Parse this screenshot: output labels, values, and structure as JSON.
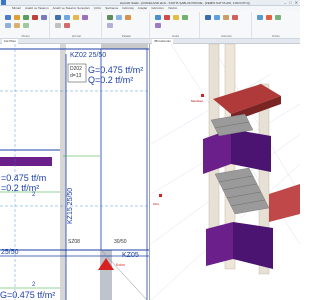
{
  "app": {
    "title": "ideCAD Statik - [CMCELAND.ideS - STATİK ŞABLON PROJE - [ZEMİN KAT PLANI, 3.80 KOTU]]",
    "window_controls": [
      "–",
      "□",
      "✕"
    ]
  },
  "menu_tabs": [
    "Mimari",
    "Analiz ve Tasarım",
    "Analiz ve Tasarım Sonuçları",
    "Çizim",
    "Şartname",
    "Görünüş",
    "Araçlar",
    "Görünüm",
    "Yardım"
  ],
  "ribbon": {
    "groups": [
      "Mimari",
      "Çizimler",
      "Paftalar",
      "Analiz",
      "Görünüm",
      "Düzen"
    ]
  },
  "view_tabs": [
    "Kat Planı",
    "3B Görünüm"
  ],
  "plan": {
    "beam_label": "KZ02 25/50",
    "slab_name": "D202",
    "slab_thickness": "d=13",
    "load_g_top": "G=0.475 tf/m²",
    "load_q_top": "Q=0.2 tf/m²",
    "load_g_left": "=0.475 tf/m",
    "load_q_left": "=0.2 tf/m²",
    "beam_vertical": "KZ15 25/50",
    "axis_mark": "SZ08",
    "dim_30_50": "30/50",
    "col_label": "KZ05",
    "beam_left_bottom": "25/50",
    "load_g_bottom": "G=0.475 tf/m²",
    "small_marks": [
      "2",
      "2"
    ],
    "red_tag": "Kolon"
  },
  "view3d": {
    "label_a": "Merdiven",
    "label_b": "Kiriş"
  },
  "colors": {
    "wall_purple": "#6a1f8a",
    "roof_red": "#b03a3a",
    "stair_grey": "#9a9a9a",
    "beam_blue": "#1c3fa8"
  }
}
